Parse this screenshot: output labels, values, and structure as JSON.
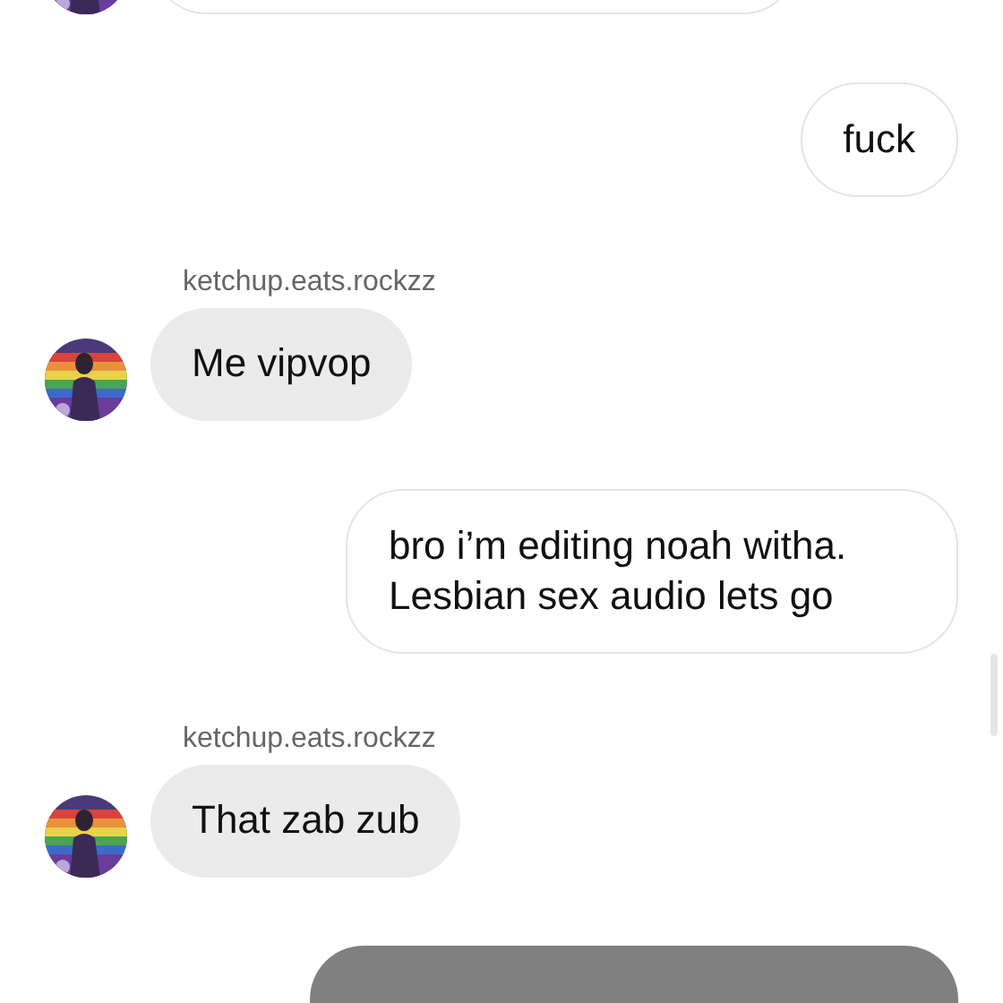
{
  "messages": [
    {
      "kind": "incoming_cut"
    },
    {
      "kind": "outgoing",
      "text": "fuck"
    },
    {
      "kind": "incoming",
      "sender": "ketchup.eats.rockzz",
      "text": "Me vipvop"
    },
    {
      "kind": "outgoing",
      "text": "bro i’m editing noah witha. Lesbian sex audio lets go"
    },
    {
      "kind": "incoming",
      "sender": "ketchup.eats.rockzz",
      "text": "That zab zub"
    },
    {
      "kind": "outgoing_media"
    }
  ]
}
